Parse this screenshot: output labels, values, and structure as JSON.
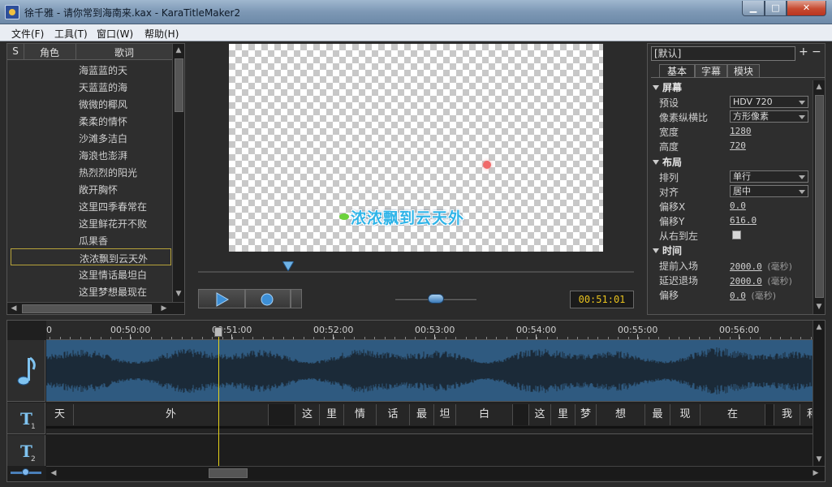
{
  "window": {
    "title": "徐千雅 - 请你常到海南来.kax - KaraTitleMaker2",
    "min_label": "▁",
    "max_label": "□",
    "close_label": "✕"
  },
  "menu": [
    "文件(F)",
    "工具(T)",
    "窗口(W)",
    "帮助(H)"
  ],
  "lyric_panel": {
    "columns": [
      "S",
      "角色",
      "歌词"
    ],
    "rows": [
      "海蓝蓝的天",
      "天蓝蓝的海",
      "微微的椰风",
      "柔柔的情怀",
      "沙滩多洁白",
      "海浪也澎湃",
      "热烈烈的阳光",
      "敞开胸怀",
      "这里四季春常在",
      "这里鲜花开不败",
      "瓜果香",
      "浓浓飘到云天外",
      "这里情话最坦白",
      "这里梦想最现在"
    ],
    "selected_index": 11
  },
  "preview": {
    "lyric": "浓浓飘到云天外"
  },
  "transport": {
    "time": "00:51:01"
  },
  "properties": {
    "preset": "[默认]",
    "add_label": "+",
    "remove_label": "−",
    "tabs": [
      "基本",
      "字幕",
      "模块"
    ],
    "active_tab": 0,
    "sections": {
      "screen": {
        "title": "屏幕",
        "preset_label": "预设",
        "preset_value": "HDV 720",
        "aspect_label": "像素纵横比",
        "aspect_value": "方形像素",
        "width_label": "宽度",
        "width_value": "1280",
        "height_label": "高度",
        "height_value": "720"
      },
      "layout": {
        "title": "布局",
        "arrange_label": "排列",
        "arrange_value": "单行",
        "align_label": "对齐",
        "align_value": "居中",
        "offset_x_label": "偏移X",
        "offset_x_value": "0.0",
        "offset_y_label": "偏移Y",
        "offset_y_value": "616.0",
        "rtl_label": "从右到左"
      },
      "time": {
        "title": "时间",
        "lead_in_label": "提前入场",
        "lead_in_value": "2000.0",
        "lead_out_label": "延迟退场",
        "lead_out_value": "2000.0",
        "offset_label": "偏移",
        "offset_value": "0.0",
        "unit": "(毫秒)"
      }
    }
  },
  "timeline": {
    "ruler_start": "0",
    "ruler_labels": [
      "00:50:00",
      "00:51:00",
      "00:52:00",
      "00:53:00",
      "00:54:00",
      "00:55:00",
      "00:56:00"
    ],
    "track_t1_chars": [
      "天",
      "外",
      "",
      "这",
      "里",
      "情",
      "话",
      "最",
      "坦",
      "白",
      "",
      "这",
      "里",
      "梦",
      "想",
      "最",
      "现",
      "在",
      "",
      "我",
      "和"
    ],
    "track_icons": [
      "music-note-icon",
      "text-track-1-icon",
      "text-track-2-icon"
    ]
  },
  "colors": {
    "waveform": "#2f5a80",
    "playhead": "#e6d21a",
    "time_display": "#e8c21e",
    "preview_text": "#2fb4e8"
  }
}
